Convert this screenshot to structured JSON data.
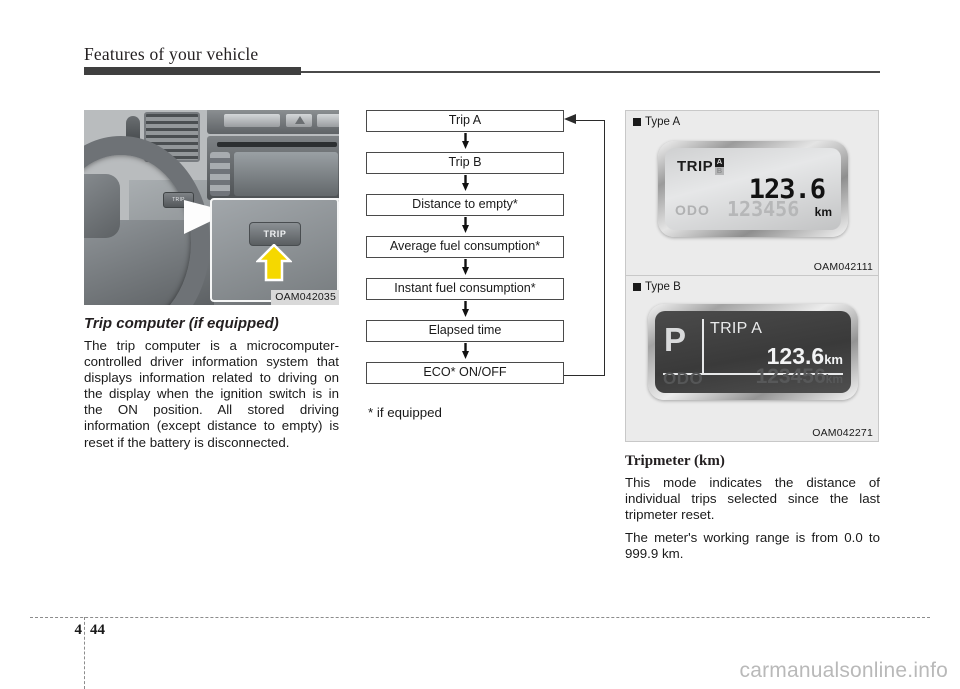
{
  "header": {
    "title": "Features of your vehicle"
  },
  "left_column": {
    "figure": {
      "caption": "OAM042035",
      "button_label_small": "TRIP",
      "button_label_large": "TRIP",
      "arrow_color": "#f5d800"
    },
    "heading": "Trip computer (if equipped)",
    "paragraph": "The trip computer is a microcomputer-controlled driver information system that displays information related to driving on the display when the ignition switch is in the ON position. All stored driving information (except distance to empty) is reset if the battery is disconnected."
  },
  "flowchart": {
    "steps": [
      "Trip A",
      "Trip B",
      "Distance to empty*",
      "Average fuel consumption*",
      "Instant fuel consumption*",
      "Elapsed time",
      "ECO* ON/OFF"
    ],
    "note": "* if equipped"
  },
  "right_column": {
    "type_a": {
      "label": "Type A",
      "caption": "OAM042111",
      "display": {
        "trip_label": "TRIP",
        "indicator_a": "A",
        "indicator_b": "B",
        "trip_value": "123.6",
        "odo_label": "ODO",
        "odo_value": "123456",
        "unit": "km"
      }
    },
    "type_b": {
      "label": "Type B",
      "caption": "OAM042271",
      "display": {
        "gear": "P",
        "trip_label": "TRIP A",
        "trip_value": "123.6",
        "trip_unit": "km",
        "odo_label": "ODO",
        "odo_value": "123456",
        "odo_unit": "km"
      }
    },
    "heading": "Tripmeter (km)",
    "paragraph_1": "This mode indicates the distance of individual trips selected since the last tripmeter reset.",
    "paragraph_2": "The meter's working range is from 0.0 to 999.9 km."
  },
  "footer": {
    "chapter": "4",
    "page": "44",
    "watermark": "carmanualsonline.info"
  }
}
